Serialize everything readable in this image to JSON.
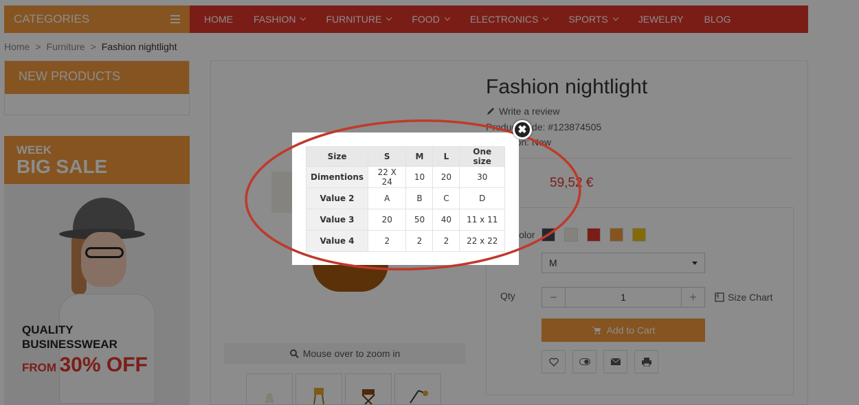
{
  "header": {
    "categories_label": "CATEGORIES",
    "nav": [
      {
        "label": "HOME",
        "dropdown": false
      },
      {
        "label": "FASHION",
        "dropdown": true
      },
      {
        "label": "FURNITURE",
        "dropdown": true
      },
      {
        "label": "FOOD",
        "dropdown": true
      },
      {
        "label": "ELECTRONICS",
        "dropdown": true
      },
      {
        "label": "SPORTS",
        "dropdown": true
      },
      {
        "label": "JEWELRY",
        "dropdown": false
      },
      {
        "label": "BLOG",
        "dropdown": false
      }
    ]
  },
  "breadcrumb": {
    "home": "Home",
    "category": "Furniture",
    "current": "Fashion nightlight",
    "separator": ">"
  },
  "sidebar": {
    "new_products_title": "NEW PRODUCTS",
    "banner": {
      "week": "WEEK",
      "big_sale": "BIG SALE",
      "line1": "QUALITY",
      "line2": "BUSINESSWEAR",
      "from": "FROM",
      "discount": "30% OFF"
    }
  },
  "product": {
    "title": "Fashion nightlight",
    "write_review": "Write a review",
    "code": "Product code: #123874505",
    "condition": "Condition: New",
    "price": "59,52 €",
    "color_label": "Color",
    "swatches": [
      "#434a54",
      "#f1ede2",
      "#e0352a",
      "#f39a3c",
      "#f1c40f"
    ],
    "size_value": "M",
    "qty_label": "Qty",
    "qty_value": "1",
    "size_chart_label": "Size Chart",
    "add_to_cart": "Add to Cart",
    "zoom_hint": "Mouse over to zoom in"
  },
  "size_table": {
    "headers": [
      "Size",
      "S",
      "M",
      "L",
      "One size"
    ],
    "rows": [
      [
        "Dimentions",
        "22 X 24",
        "10",
        "20",
        "30"
      ],
      [
        "Value 2",
        "A",
        "B",
        "C",
        "D"
      ],
      [
        "Value 3",
        "20",
        "50",
        "40",
        "11 x 11"
      ],
      [
        "Value 4",
        "2",
        "2",
        "2",
        "22 x 22"
      ]
    ]
  },
  "colors": {
    "accent_orange": "#f39a3c",
    "nav_red": "#e0352a",
    "annotation_red": "#c0392b"
  }
}
